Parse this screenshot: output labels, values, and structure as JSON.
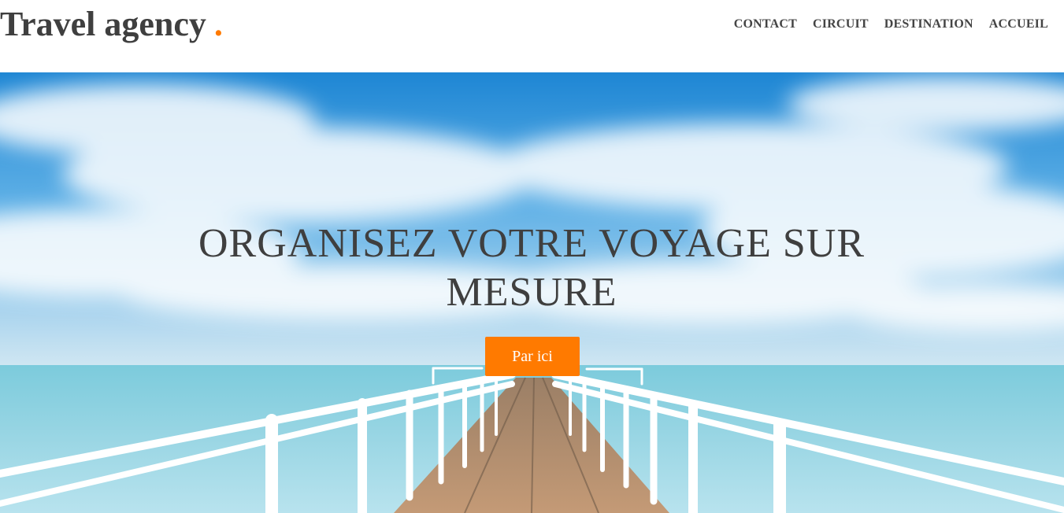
{
  "header": {
    "logo_text": "Travel agency",
    "logo_dot": ".",
    "nav": [
      {
        "label": "CONTACT"
      },
      {
        "label": "CIRCUIT"
      },
      {
        "label": "DESTINATION"
      },
      {
        "label": "ACCUEIL"
      }
    ]
  },
  "hero": {
    "title": "ORGANISEZ VOTRE VOYAGE SUR MESURE",
    "cta_label": "Par ici"
  },
  "colors": {
    "accent": "#ff7a00",
    "text": "#3f3f3f",
    "sky": "#2f8fd6",
    "sea": "#8fd0e0"
  }
}
